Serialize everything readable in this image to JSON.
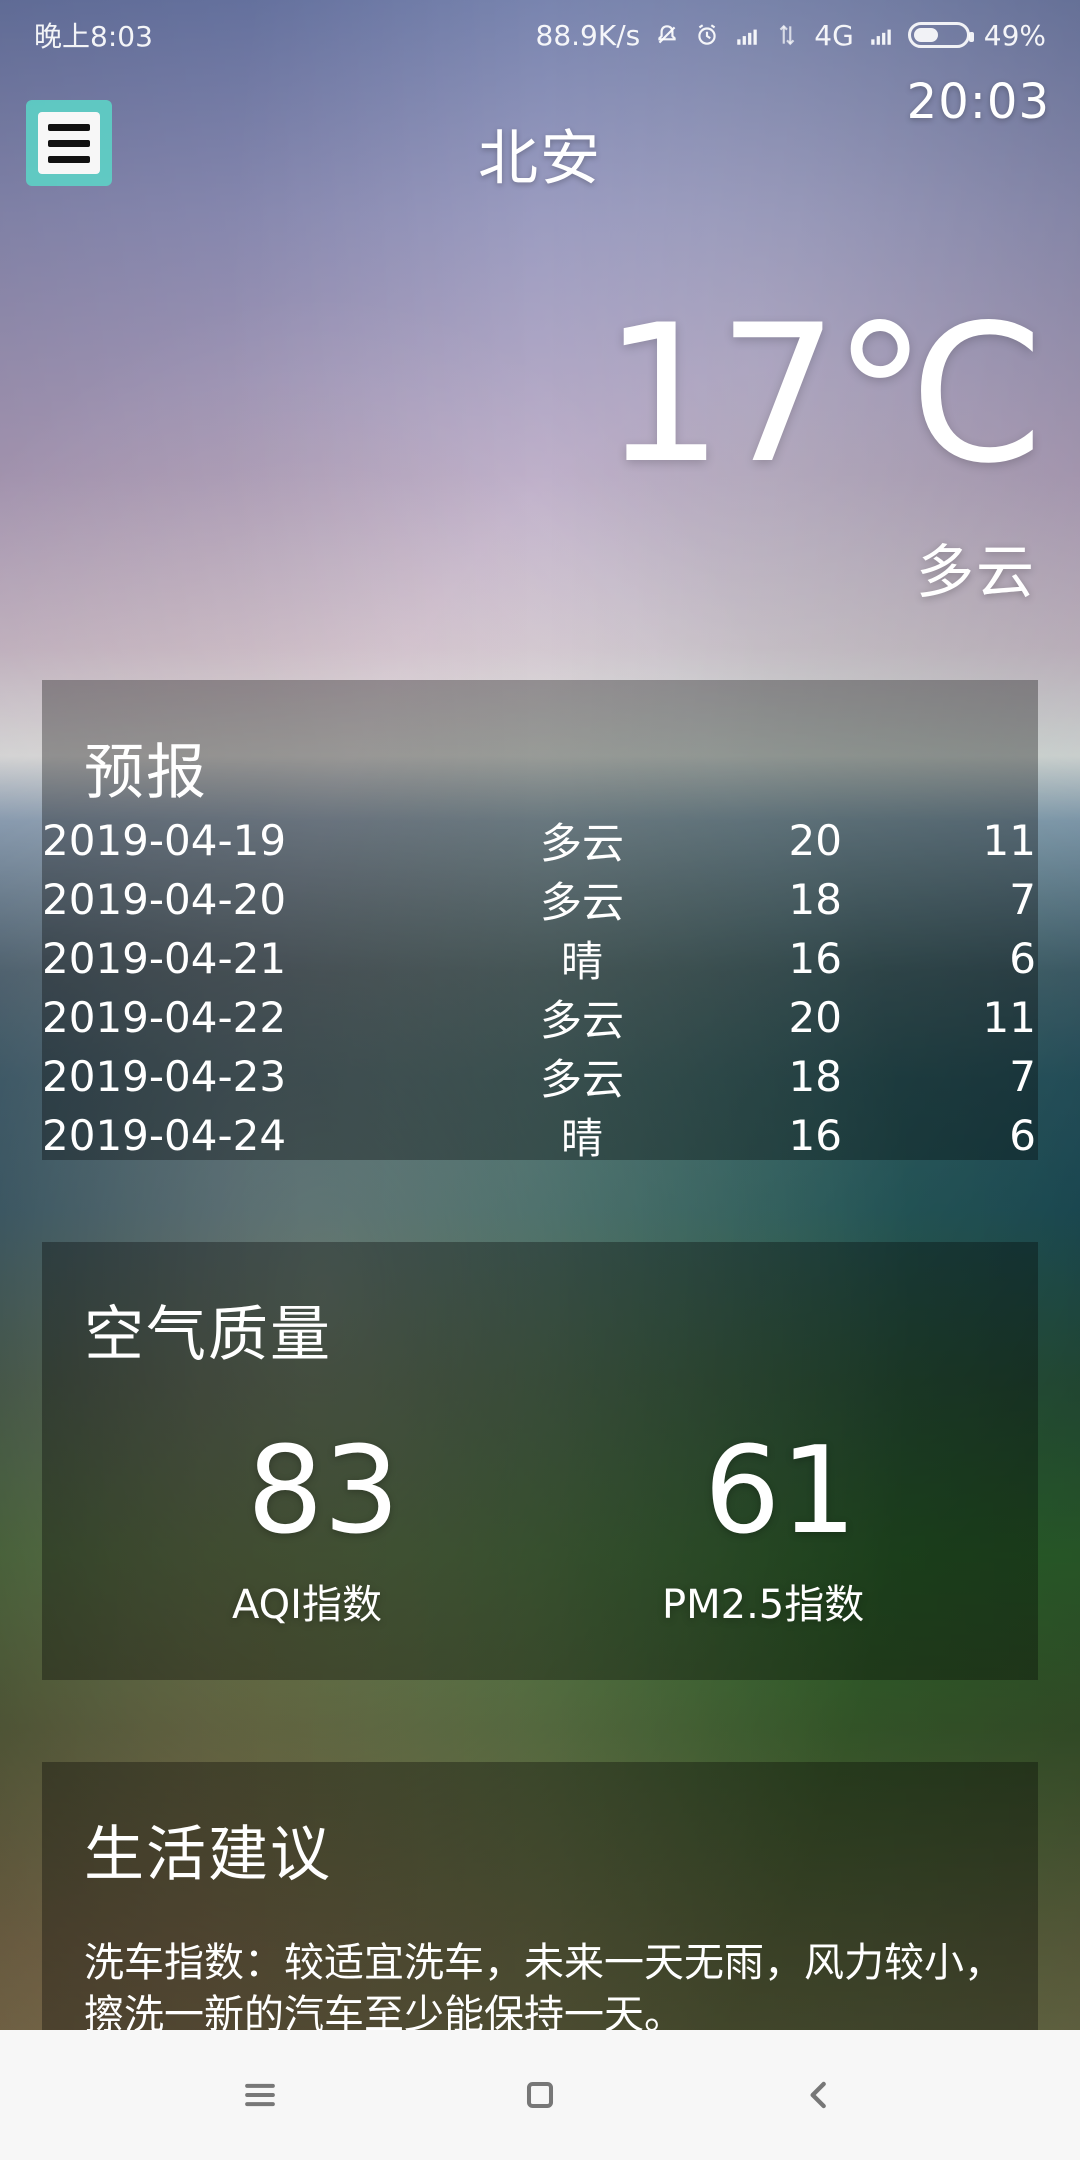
{
  "status_bar": {
    "time": "晚上8:03",
    "network_speed": "88.9K/s",
    "network_type": "4G",
    "battery_percent": "49%",
    "battery_level": 0.49
  },
  "header": {
    "menu_icon": "menu-icon",
    "city": "北安",
    "update_time": "20:03"
  },
  "now": {
    "temperature": "17℃",
    "weather": "多云"
  },
  "forecast": {
    "title": "预报",
    "items": [
      {
        "date": "2019-04-19",
        "weather": "多云",
        "max": "20",
        "min": "11"
      },
      {
        "date": "2019-04-20",
        "weather": "多云",
        "max": "18",
        "min": "7"
      },
      {
        "date": "2019-04-21",
        "weather": "晴",
        "max": "16",
        "min": "6"
      },
      {
        "date": "2019-04-22",
        "weather": "多云",
        "max": "20",
        "min": "11"
      },
      {
        "date": "2019-04-23",
        "weather": "多云",
        "max": "18",
        "min": "7"
      },
      {
        "date": "2019-04-24",
        "weather": "晴",
        "max": "16",
        "min": "6"
      }
    ]
  },
  "air_quality": {
    "title": "空气质量",
    "aqi_value": "83",
    "aqi_label": "AQI指数",
    "pm25_value": "61",
    "pm25_label": "PM2.5指数"
  },
  "suggestion": {
    "title": "生活建议",
    "text": "洗车指数：较适宜洗车，未来一天无雨，风力较小，擦洗一新的汽车至少能保持一天。"
  },
  "nav_bar": {
    "icons": [
      "menu-icon",
      "home-icon",
      "back-icon"
    ]
  }
}
